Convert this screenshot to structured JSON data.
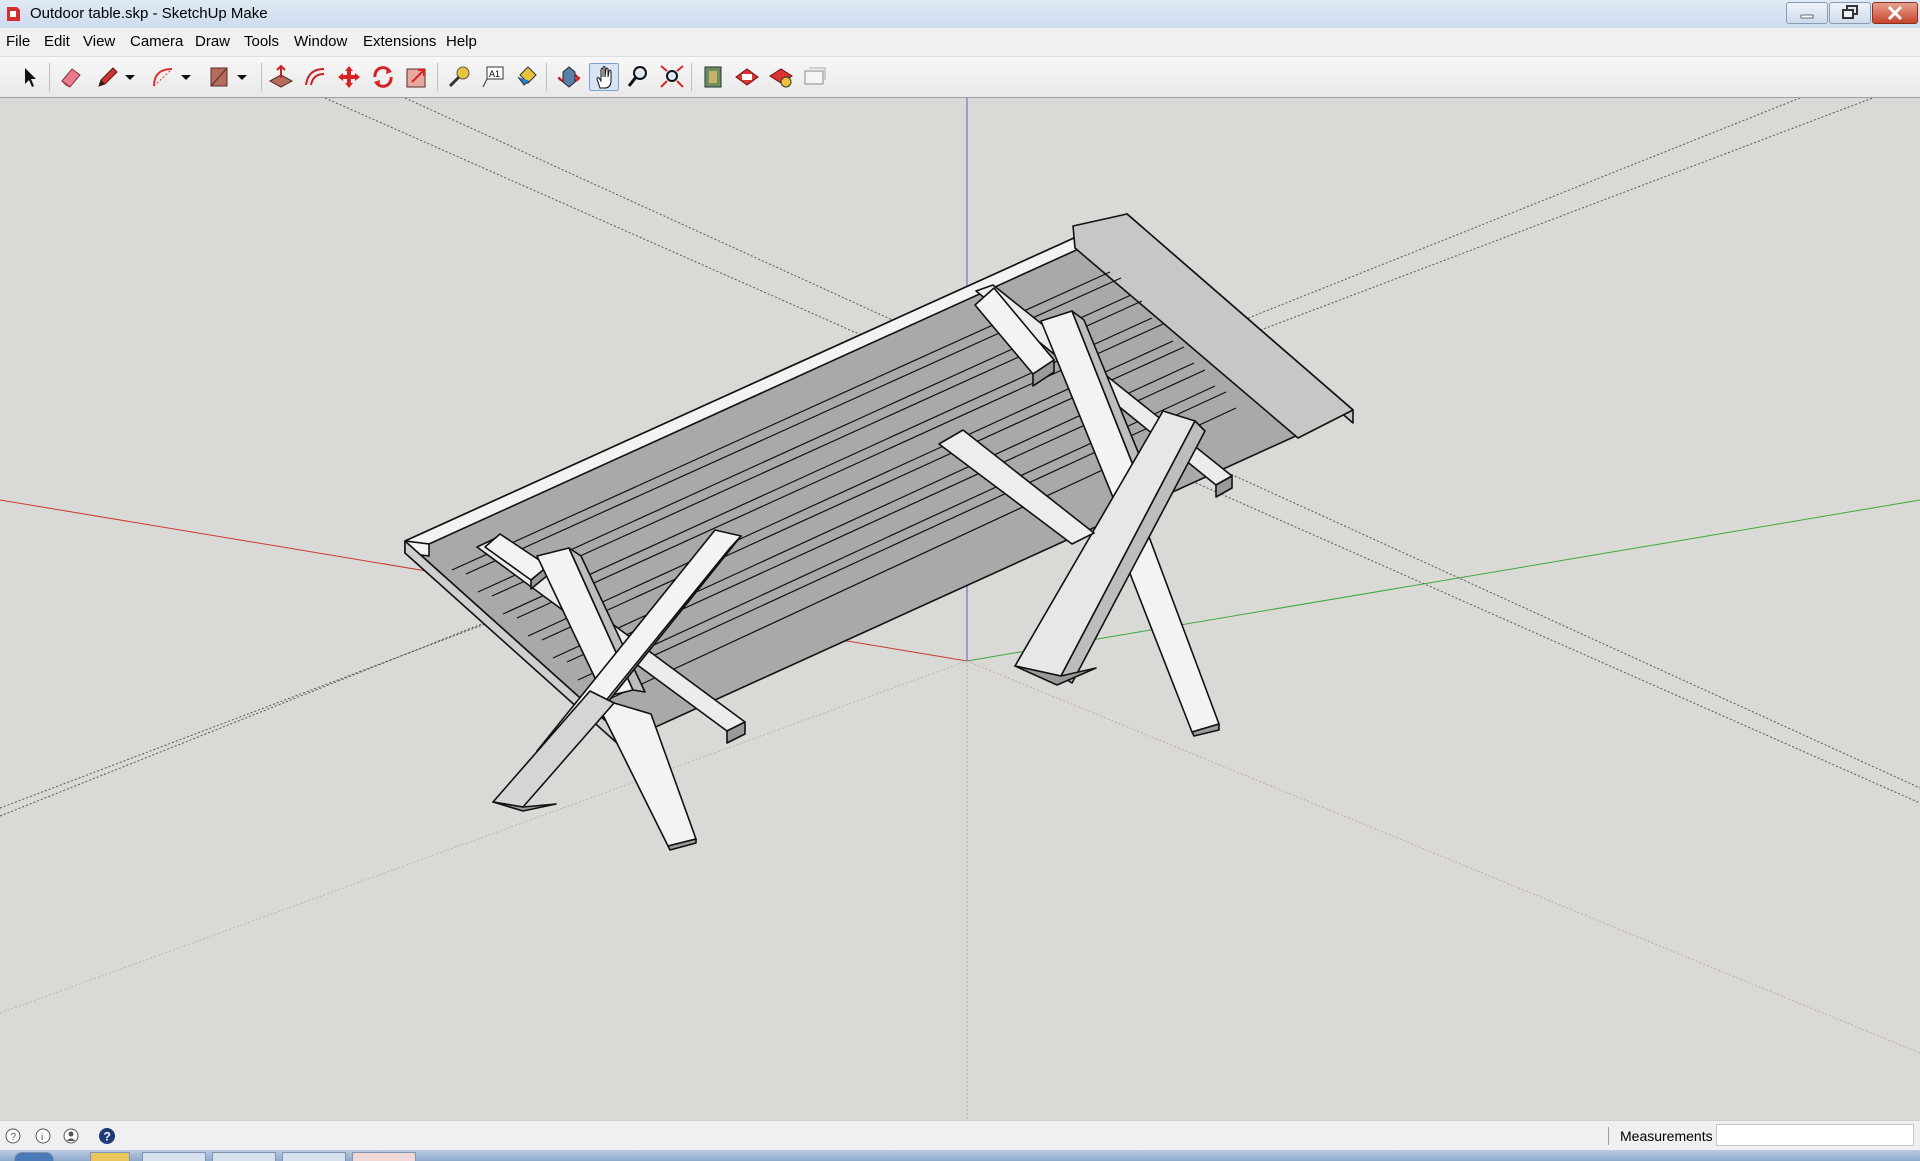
{
  "window": {
    "title": "Outdoor table.skp - SketchUp Make",
    "controls": [
      "minimize-icon",
      "restore-icon",
      "close-icon"
    ]
  },
  "menu": {
    "items": [
      "File",
      "Edit",
      "View",
      "Camera",
      "Draw",
      "Tools",
      "Window",
      "Extensions",
      "Help"
    ]
  },
  "toolbar": {
    "tools": [
      "select-icon",
      "eraser-icon",
      "pencil-icon",
      "dropdown-arrow-icon",
      "arc-icon",
      "dropdown-arrow-icon",
      "rectangle-icon",
      "dropdown-arrow-icon",
      "push-pull-icon",
      "offset-icon",
      "move-icon",
      "rotate-icon",
      "scale-icon",
      "tape-measure-icon",
      "text-icon",
      "paint-bucket-icon",
      "orbit-icon",
      "pan-icon",
      "zoom-icon",
      "zoom-extents-icon",
      "warehouse-icon",
      "extension-warehouse-icon",
      "share-model-icon",
      "layout-icon"
    ],
    "active_tool": "pan-icon"
  },
  "viewport": {
    "model": "outdoor table",
    "axis_colors": {
      "red": "#c83a3a",
      "green": "#3ea83e",
      "blue": "#5a5ac8"
    }
  },
  "status": {
    "icons": [
      "geo-location-icon",
      "credits-icon",
      "user-icon",
      "help-icon"
    ],
    "measurements_label": "Measurements",
    "measurements_value": ""
  }
}
